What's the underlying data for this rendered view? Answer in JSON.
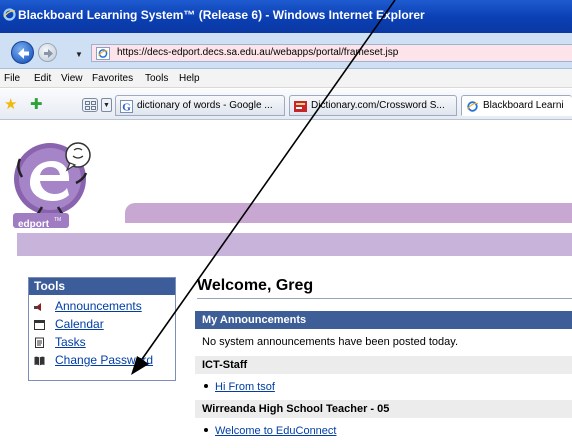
{
  "window": {
    "title": "Blackboard Learning System™ (Release 6) - Windows Internet Explorer"
  },
  "address_bar": {
    "url": "https://decs-edport.decs.sa.edu.au/webapps/portal/frameset.jsp"
  },
  "menu": {
    "items": [
      "File",
      "Edit",
      "View",
      "Favorites",
      "Tools",
      "Help"
    ]
  },
  "tabs": [
    {
      "label": "dictionary of words - Google ...",
      "icon": "google-icon",
      "active": false
    },
    {
      "label": "Dictionary.com/Crossword S...",
      "icon": "dictionary-icon",
      "active": false
    },
    {
      "label": "Blackboard Learni",
      "icon": "ie-icon",
      "active": true
    }
  ],
  "logo": {
    "text": "edport",
    "mark": "TM"
  },
  "tools": {
    "title": "Tools",
    "items": [
      {
        "label": "Announcements",
        "icon": "announcements-icon"
      },
      {
        "label": "Calendar",
        "icon": "calendar-icon"
      },
      {
        "label": "Tasks",
        "icon": "tasks-icon"
      },
      {
        "label": "Change Password",
        "icon": "password-icon"
      }
    ]
  },
  "welcome": "Welcome, Greg",
  "announcements": {
    "title": "My Announcements",
    "system_message": "No system announcements have been posted today.",
    "groups": [
      {
        "name": "ICT-Staff",
        "items": [
          "Hi From tsof"
        ]
      },
      {
        "name": "Wirreanda High School Teacher - 05",
        "items": [
          "Welcome to EduConnect"
        ]
      }
    ]
  },
  "colors": {
    "title_bar": "#0a3fb4",
    "panel_header": "#3e5e97",
    "banner_purple": "#c8b4da",
    "link": "#003da5"
  }
}
